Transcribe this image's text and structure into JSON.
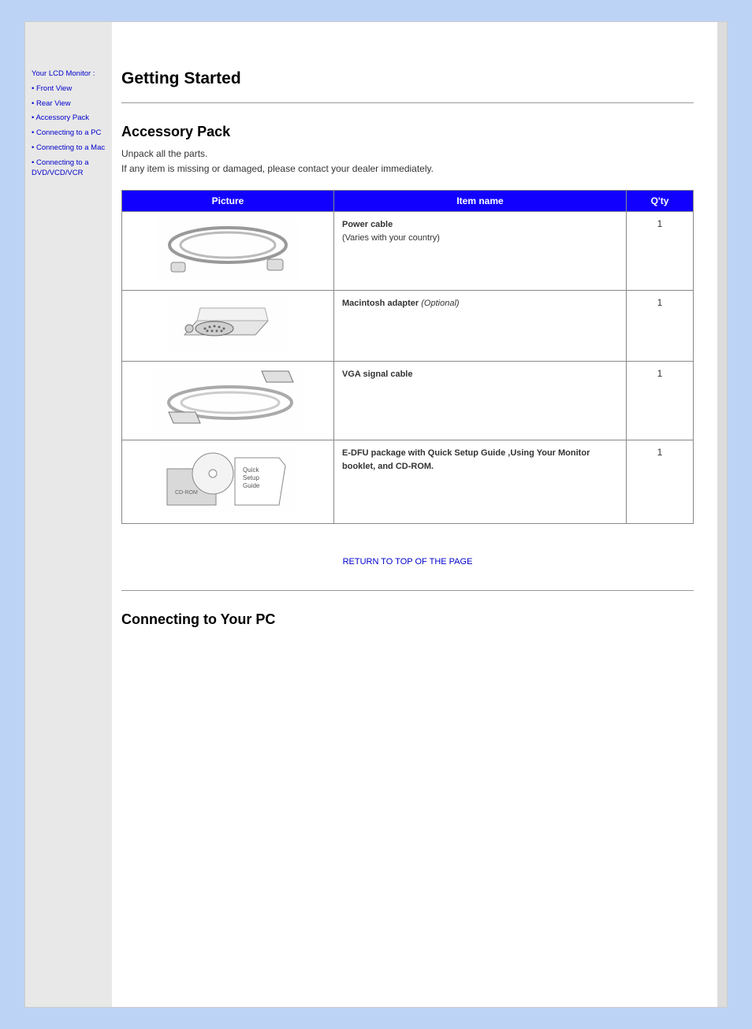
{
  "page": {
    "title": "Getting Started",
    "sidebar": [
      "Your LCD Monitor :",
      "Front View",
      "Rear View",
      "Accessory Pack",
      "Connecting to a PC",
      "Connecting to a Mac",
      "Connecting to a DVD/VCD/VCR"
    ]
  },
  "section1": {
    "heading": "Accessory Pack",
    "intro_1": "Unpack all the parts.",
    "intro_2": "If any item is missing or damaged, please contact your dealer immediately.",
    "table": {
      "headers": [
        "Picture",
        "Item name",
        "Q'ty"
      ],
      "rows": [
        {
          "desc_title": "Power cable",
          "desc_note": "(Varies with your country)",
          "qty": "1"
        },
        {
          "desc_title": "Macintosh adapter",
          "desc_note_em": "(Optional)",
          "qty": "1"
        },
        {
          "desc_title": "VGA signal cable",
          "desc_note": "",
          "qty": "1"
        },
        {
          "desc_title": "E-DFU package with Quick Setup Guide ,Using Your Monitor booklet, and CD-ROM.",
          "desc_note": "",
          "qty": "1"
        }
      ]
    },
    "return_link": "RETURN TO TOP OF THE PAGE"
  },
  "section2": {
    "heading": "Connecting to Your PC"
  }
}
